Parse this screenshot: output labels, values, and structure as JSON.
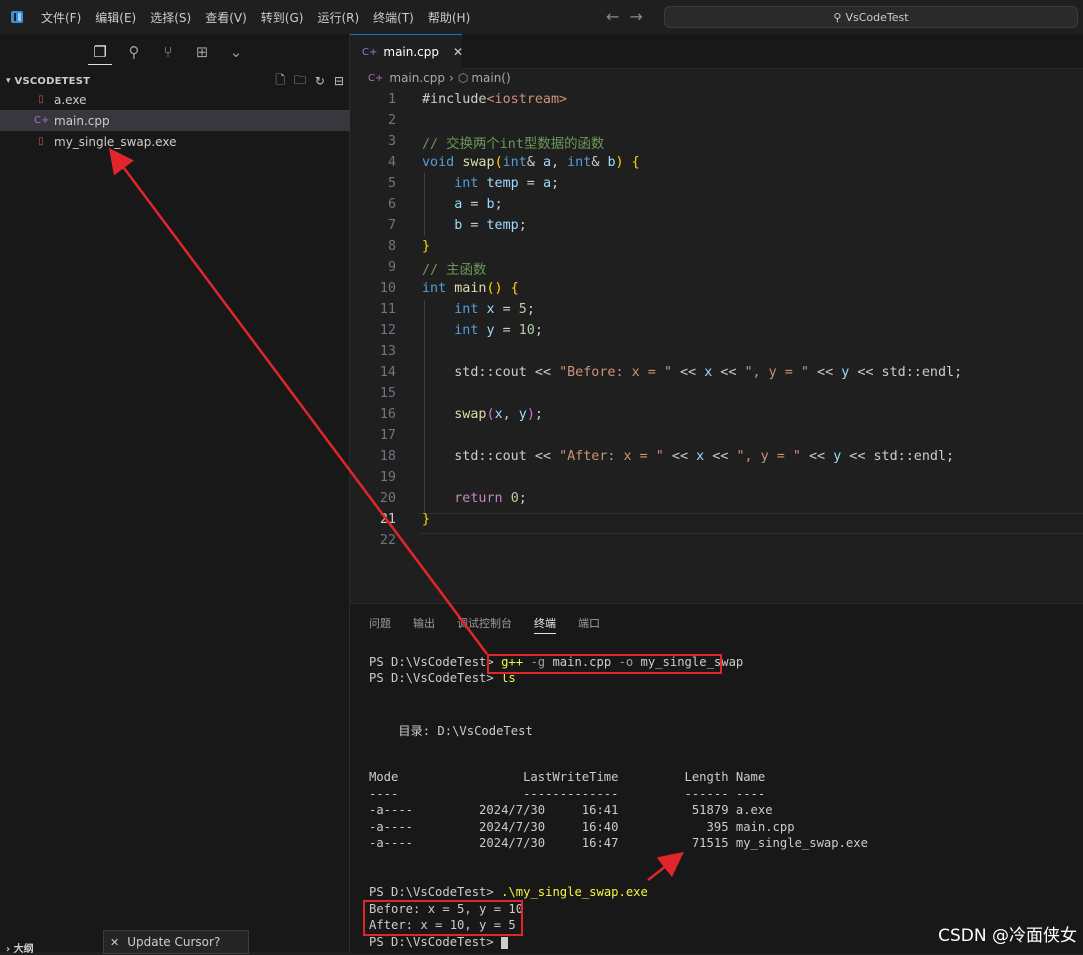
{
  "menu": [
    "文件(F)",
    "编辑(E)",
    "选择(S)",
    "查看(V)",
    "转到(G)",
    "运行(R)",
    "终端(T)",
    "帮助(H)"
  ],
  "search": {
    "text": "VsCodeTest"
  },
  "sidebar": {
    "section_title": "VSCODETEST",
    "files": [
      {
        "name": "a.exe",
        "icon": "exe-file-icon"
      },
      {
        "name": "main.cpp",
        "icon": "cpp-file-icon",
        "selected": true
      },
      {
        "name": "my_single_swap.exe",
        "icon": "exe-file-icon"
      }
    ],
    "outline_label": "大纲",
    "tooltip": "Update Cursor?"
  },
  "editor": {
    "tab_label": "main.cpp",
    "breadcrumb": [
      "main.cpp",
      "main()"
    ],
    "line_numbers": [
      "1",
      "2",
      "3",
      "4",
      "5",
      "6",
      "7",
      "8",
      "9",
      "10",
      "11",
      "12",
      "13",
      "14",
      "15",
      "16",
      "17",
      "18",
      "19",
      "20",
      "21",
      "22"
    ],
    "current_line": 21
  },
  "panel": {
    "tabs": [
      "问题",
      "输出",
      "调试控制台",
      "终端",
      "端口"
    ],
    "active_tab": "终端",
    "terminal": {
      "prompt": "PS D:\\VsCodeTest>",
      "cmd1": [
        "g++",
        " -g ",
        "main.cpp",
        " -o ",
        "my_single_swap"
      ],
      "cmd2": "ls",
      "dir_line": "    目录: D:\\VsCodeTest",
      "table_header": "Mode                 LastWriteTime         Length Name",
      "table_rule": "----                 -------------         ------ ----",
      "rows": [
        "-a----         2024/7/30     16:41          51879 a.exe",
        "-a----         2024/7/30     16:40            395 main.cpp",
        "-a----         2024/7/30     16:47          71515 my_single_swap.exe"
      ],
      "cmd3": ".\\my_single_swap.exe",
      "out1": "Before: x = 5, y = 10",
      "out2": "After: x = 10, y = 5"
    }
  },
  "watermark": "CSDN @冷面侠女",
  "colors": {
    "annotation_red": "#e0262b",
    "accent": "#0078d4"
  }
}
